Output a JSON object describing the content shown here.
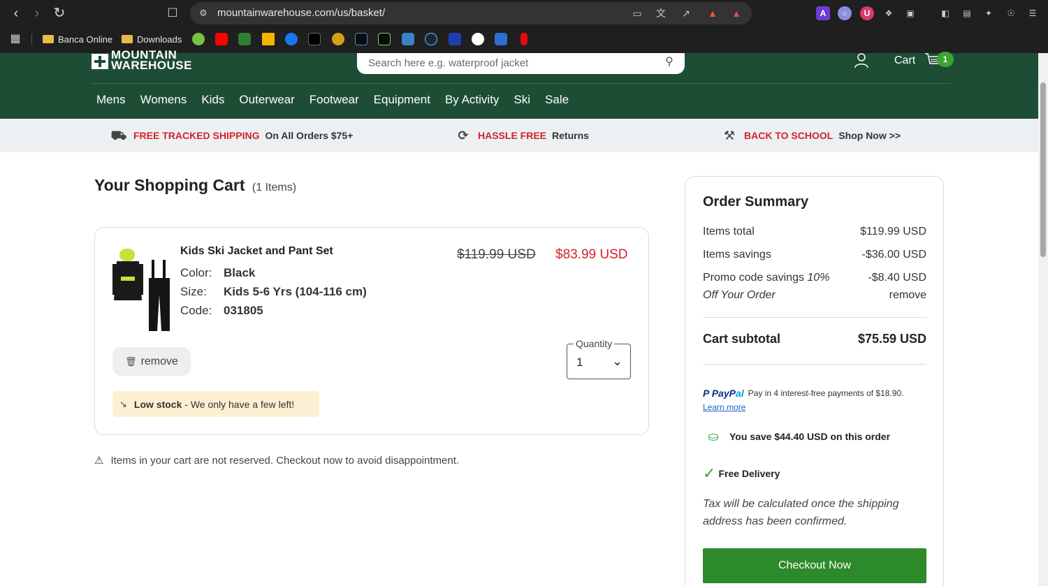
{
  "browser": {
    "url": "mountainwarehouse.com/us/basket/",
    "bookmarks": [
      "Banca Online",
      "Downloads"
    ],
    "ext_colors": [
      "#6e3bd1",
      "#8a8fe0",
      "#d93a6a",
      "#444"
    ]
  },
  "header": {
    "logo_line1": "MOUNTAIN",
    "logo_line2": "WAREHOUSE",
    "search_placeholder": "Search here e.g. waterproof jacket",
    "cart_label": "Cart",
    "cart_count": "1",
    "nav": [
      "Mens",
      "Womens",
      "Kids",
      "Outerwear",
      "Footwear",
      "Equipment",
      "By Activity",
      "Ski",
      "Sale"
    ]
  },
  "promos": [
    {
      "highlight": "FREE TRACKED SHIPPING",
      "text": "On All Orders $75+"
    },
    {
      "highlight": "HASSLE FREE",
      "text": "Returns"
    },
    {
      "highlight": "BACK TO SCHOOL",
      "text": "Shop Now >>"
    }
  ],
  "cart": {
    "title": "Your Shopping Cart",
    "count": "(1 Items)",
    "item": {
      "name": "Kids Ski Jacket and Pant Set",
      "color_label": "Color:",
      "color": "Black",
      "size_label": "Size:",
      "size": "Kids 5-6 Yrs (104-116 cm)",
      "code_label": "Code:",
      "code": "031805",
      "old_price": "$119.99 USD",
      "price": "$83.99 USD",
      "remove_label": "remove",
      "quantity_label": "Quantity",
      "quantity": "1",
      "stock_bold": "Low stock",
      "stock_text": " - We only have a few left!"
    },
    "reserve_note": "Items in your cart are not reserved. Checkout now to avoid disappointment."
  },
  "summary": {
    "title": "Order Summary",
    "items_total_label": "Items total",
    "items_total": "$119.99 USD",
    "items_savings_label": "Items savings",
    "items_savings": "-$36.00 USD",
    "promo_label": "Promo code savings ",
    "promo_name": "10% Off Your Order",
    "promo_value": "-$8.40 USD",
    "promo_remove": "remove",
    "subtotal_label": "Cart subtotal",
    "subtotal": "$75.59 USD",
    "paypal_text": "Pay in 4 interest-free payments of $18.90.",
    "paypal_learn": "Learn more",
    "save_text": "You save $44.40 USD on this order",
    "delivery_text": "Free Delivery",
    "tax_note": "Tax will be calculated once the shipping address has been confirmed.",
    "checkout_label": "Checkout Now"
  },
  "colors": {
    "brand_green": "#1e4d36",
    "sale_red": "#d2232a",
    "checkout_green": "#2d8a2a"
  }
}
